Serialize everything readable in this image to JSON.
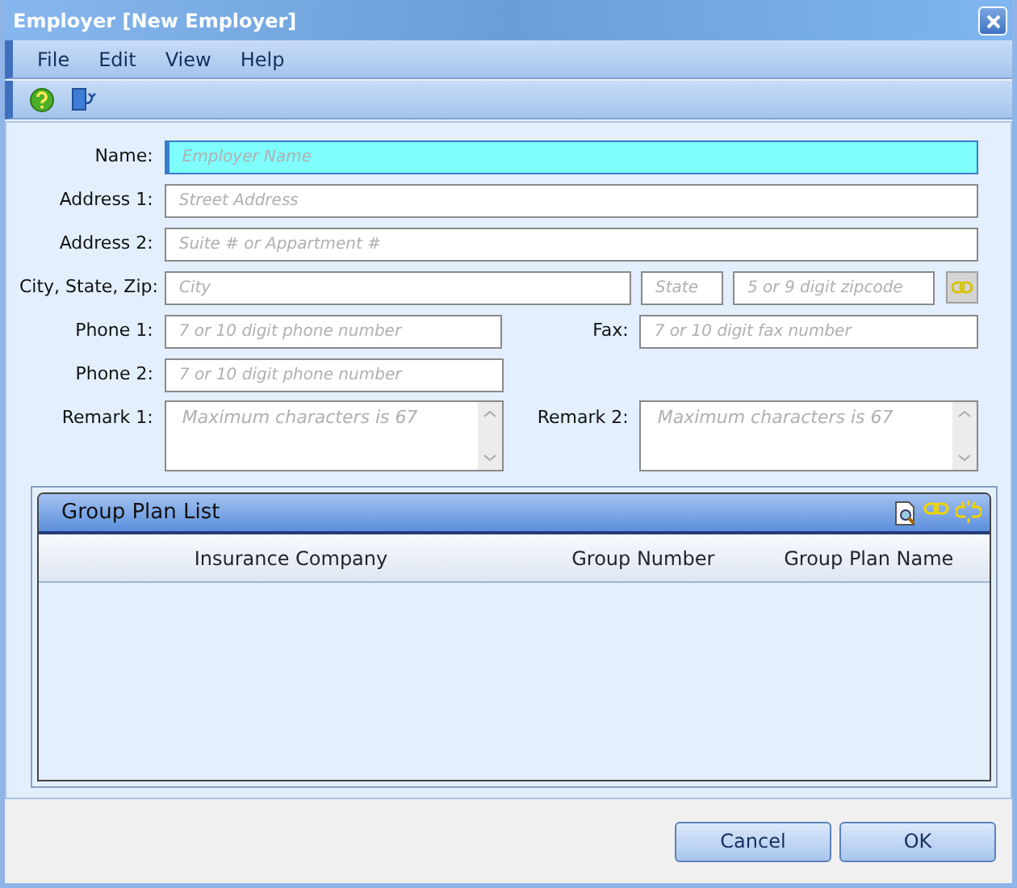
{
  "window": {
    "title": "Employer [New Employer]"
  },
  "menu": [
    "File",
    "Edit",
    "View",
    "Help"
  ],
  "toolbar": [
    {
      "kind": "help"
    },
    {
      "kind": "exit"
    }
  ],
  "form": {
    "name": {
      "label": "Name:",
      "placeholder": "Employer Name",
      "focused": true
    },
    "address1": {
      "label": "Address 1:",
      "placeholder": "Street Address",
      "focused": false
    },
    "address2": {
      "label": "Address 2:",
      "placeholder": "Suite # or Appartment #",
      "focused": false
    },
    "city_state_zip": {
      "label": "City, State, Zip:",
      "city": {
        "placeholder": "City"
      },
      "state": {
        "placeholder": "State"
      },
      "zip": {
        "placeholder": "5 or 9 digit zipcode"
      }
    },
    "phone1": {
      "label": "Phone 1:",
      "placeholder": "7 or 10 digit phone number"
    },
    "fax": {
      "label": "Fax:",
      "placeholder": "7 or 10 digit fax number"
    },
    "phone2": {
      "label": "Phone 2:",
      "placeholder": "7 or 10 digit phone number"
    },
    "remark1": {
      "label": "Remark 1:",
      "placeholder": "Maximum characters is 67"
    },
    "remark2": {
      "label": "Remark 2:",
      "placeholder": "Maximum characters is 67"
    }
  },
  "group_plan_list": {
    "title": "Group Plan List",
    "columns": [
      "Insurance Company",
      "Group Number",
      "Group Plan Name"
    ]
  },
  "buttons": [
    "Cancel",
    "OK"
  ]
}
